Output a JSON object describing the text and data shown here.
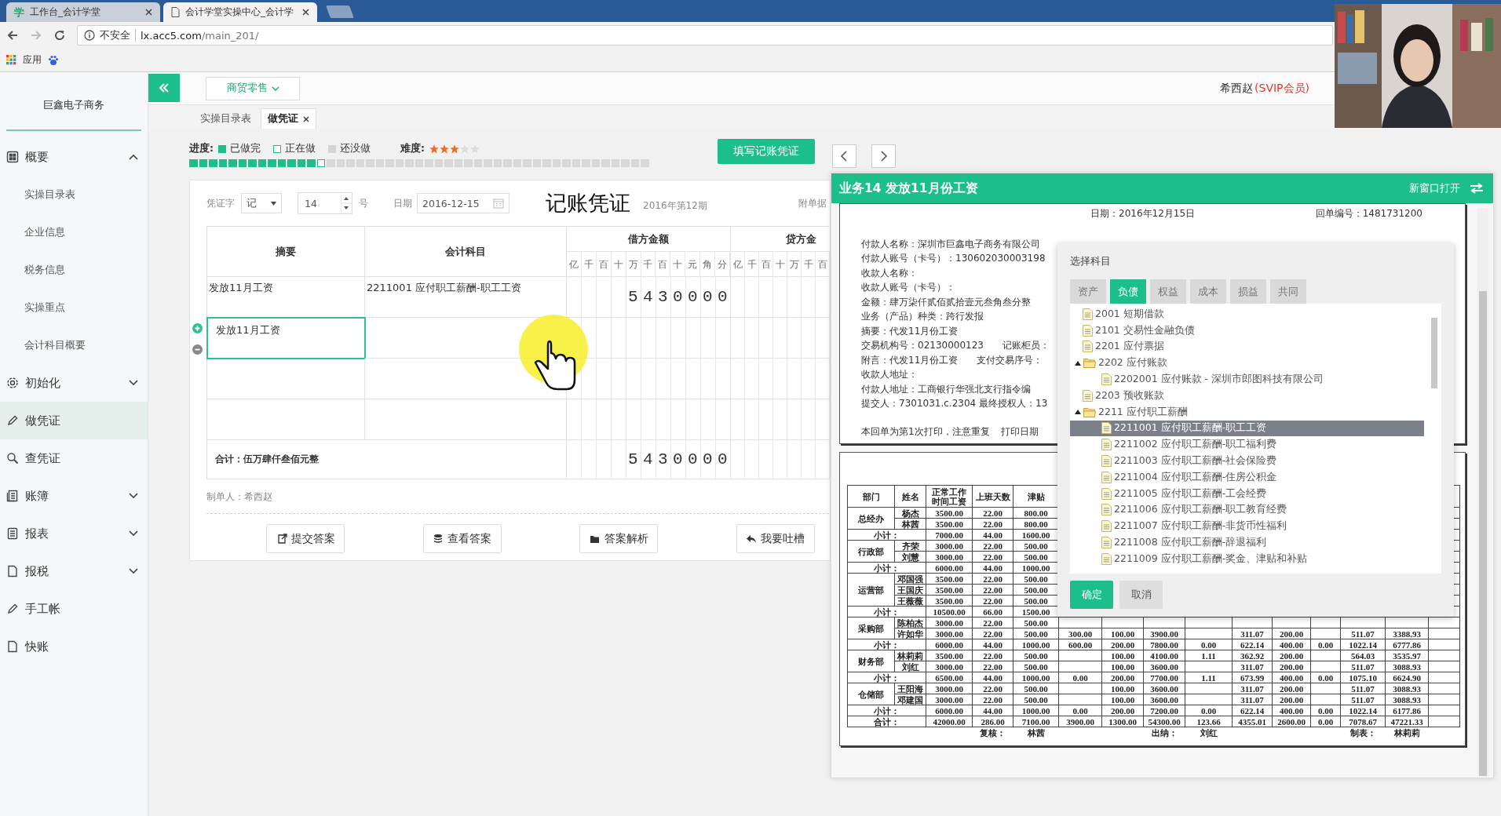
{
  "browser": {
    "tabs": [
      {
        "icon_text": "学",
        "title": "工作台_会计学堂",
        "selected": false
      },
      {
        "title": "会计学堂实操中心_会计学",
        "selected": true
      }
    ],
    "security": "不安全",
    "url_host": "lx.acc5.com",
    "url_path": "/main_201/",
    "bookmarks": [
      "应用"
    ]
  },
  "sidebar": {
    "company": "巨鑫电子商务",
    "items": [
      {
        "label": "概要",
        "selected": false,
        "expanded": true,
        "children": [
          {
            "label": "实操目录表",
            "selected": false
          },
          {
            "label": "企业信息",
            "selected": false
          },
          {
            "label": "税务信息",
            "selected": false
          },
          {
            "label": "实操重点",
            "selected": false
          },
          {
            "label": "会计科目概要",
            "selected": false
          }
        ]
      },
      {
        "label": "初始化",
        "selected": false,
        "expanded": false
      },
      {
        "label": "做凭证",
        "selected": true
      },
      {
        "label": "查凭证",
        "selected": false
      },
      {
        "label": "账簿",
        "selected": false,
        "expanded": false
      },
      {
        "label": "报表",
        "selected": false,
        "expanded": false
      },
      {
        "label": "报税",
        "selected": false,
        "expanded": false
      },
      {
        "label": "手工帐",
        "selected": false
      },
      {
        "label": "快账",
        "selected": false
      }
    ]
  },
  "topbar": {
    "industry": "商贸零售",
    "user": "希西赵",
    "membership": "(SVIP会员)"
  },
  "tabs": [
    {
      "label": "实操目录表",
      "selected": false,
      "closable": false
    },
    {
      "label": "做凭证",
      "selected": true,
      "closable": true
    }
  ],
  "progress": {
    "label": "进度:",
    "legend": [
      {
        "kind": "done",
        "label": "已做完"
      },
      {
        "kind": "doing",
        "label": "正在做"
      },
      {
        "kind": "todo",
        "label": "还没做"
      }
    ],
    "difficulty_label": "难度:",
    "stars": 3,
    "segments": [
      {
        "kind": "done"
      },
      {
        "kind": "done"
      },
      {
        "kind": "done"
      },
      {
        "kind": "done"
      },
      {
        "kind": "done"
      },
      {
        "kind": "done"
      },
      {
        "kind": "done"
      },
      {
        "kind": "done"
      },
      {
        "kind": "done"
      },
      {
        "kind": "done"
      },
      {
        "kind": "done"
      },
      {
        "kind": "done"
      },
      {
        "kind": "done"
      },
      {
        "kind": "doing"
      },
      {
        "kind": "todo"
      },
      {
        "kind": "todo"
      },
      {
        "kind": "todo"
      },
      {
        "kind": "todo"
      },
      {
        "kind": "todo"
      },
      {
        "kind": "todo"
      },
      {
        "kind": "todo"
      },
      {
        "kind": "todo"
      },
      {
        "kind": "todo"
      },
      {
        "kind": "todo"
      },
      {
        "kind": "todo"
      },
      {
        "kind": "todo"
      },
      {
        "kind": "todo"
      },
      {
        "kind": "todo"
      },
      {
        "kind": "todo"
      },
      {
        "kind": "todo"
      },
      {
        "kind": "todo"
      },
      {
        "kind": "todo"
      },
      {
        "kind": "todo"
      },
      {
        "kind": "todo"
      },
      {
        "kind": "todo"
      },
      {
        "kind": "todo"
      },
      {
        "kind": "todo"
      },
      {
        "kind": "todo"
      },
      {
        "kind": "todo"
      },
      {
        "kind": "todo"
      },
      {
        "kind": "todo"
      },
      {
        "kind": "todo"
      },
      {
        "kind": "todo"
      },
      {
        "kind": "todo"
      },
      {
        "kind": "todo"
      },
      {
        "kind": "todo"
      },
      {
        "kind": "todo"
      }
    ]
  },
  "fill_button": "填写记账凭证",
  "voucher": {
    "type_label": "凭证字",
    "type_value": "记",
    "number": "14",
    "number_suffix": "号",
    "date_label": "日期",
    "date": "2016-12-15",
    "title": "记账凭证",
    "period": "2016年第12期",
    "attachments_label": "附单据",
    "columns": {
      "summary": "摘要",
      "account": "会计科目",
      "debit": "借方金额",
      "credit": "贷方金"
    },
    "debit_units": [
      "亿",
      "千",
      "百",
      "十",
      "万",
      "千",
      "百",
      "十",
      "元",
      "角",
      "分"
    ],
    "credit_units": [
      "亿",
      "千",
      "百",
      "十",
      "万",
      "千",
      "百"
    ],
    "entries": [
      {
        "summary": "发放11月工资",
        "account": "2211001 应付职工薪酬-职工工资",
        "debit": "5430000",
        "editing": false
      },
      {
        "summary": "发放11月工资",
        "editing": true
      },
      {
        "editing": false
      },
      {
        "editing": false
      }
    ],
    "total": {
      "label": "合计：伍万肆仟叁佰元整",
      "debit": "5430000"
    },
    "preparer": "制单人：希西赵",
    "actions": [
      "提交答案",
      "查看答案",
      "答案解析",
      "我要吐槽"
    ]
  },
  "task_panel": {
    "title": "业务14 发放11月份工资",
    "open_new": "新窗口打开",
    "receipt": {
      "date": "日期：2016年12月15日",
      "receipt_no": "回单编号：1481731200",
      "lines": [
        [
          "付款人名称：深圳市巨鑫电子商务有限公司"
        ],
        [
          "付款人账号（卡号）：130602030003198"
        ],
        [
          "收款人名称："
        ],
        [
          "收款人账号（卡号）："
        ],
        [
          "金额：肆万柒仟贰佰贰拾壹元叁角叁分整"
        ],
        [
          "业务（产品）种类：跨行发报"
        ],
        [
          "摘要：代发11月份工资"
        ],
        [
          "交易机构号：02130000123",
          "记账柜员："
        ],
        [
          "附言：代发11月份工资",
          "支付交易序号："
        ],
        [
          "收款人地址："
        ],
        [
          "付款人地址：工商银行华强北支行指令编"
        ],
        [
          "提交人：7301031.c.2304 最终授权人：13"
        ]
      ],
      "note": [
        "本回单为第1次打印，注意重复",
        "打印日期"
      ]
    },
    "payroll": {
      "headers": [
        "部门",
        "姓名",
        "正常工作时间工资",
        "上班天数",
        "津贴"
      ],
      "groups": [
        {
          "dept": "总经办",
          "rows": [
            {
              "name": "杨杰",
              "values": [
                "3500.00",
                "22.00",
                "800.00"
              ]
            },
            {
              "name": "林茜",
              "values": [
                "3500.00",
                "22.00",
                "800.00"
              ]
            }
          ],
          "subtotal": {
            "label": "小计：",
            "values": [
              "7000.00",
              "44.00",
              "1600.00"
            ]
          }
        },
        {
          "dept": "行政部",
          "rows": [
            {
              "name": "齐荣",
              "values": [
                "3000.00",
                "22.00",
                "500.00"
              ]
            },
            {
              "name": "刘慧",
              "values": [
                "3000.00",
                "22.00",
                "500.00"
              ]
            }
          ],
          "subtotal": {
            "label": "小计：",
            "values": [
              "6000.00",
              "44.00",
              "1000.00"
            ]
          }
        },
        {
          "dept": "运营部",
          "rows": [
            {
              "name": "邓国强",
              "values": [
                "3500.00",
                "22.00",
                "500.00"
              ]
            },
            {
              "name": "王国庆",
              "values": [
                "3500.00",
                "22.00",
                "500.00"
              ]
            },
            {
              "name": "王薇薇",
              "values": [
                "3500.00",
                "22.00",
                "500.00"
              ]
            }
          ],
          "subtotal": {
            "label": "小计：",
            "values": [
              "10500.00",
              "66.00",
              "1500.00"
            ]
          }
        },
        {
          "dept": "采购部",
          "rows": [
            {
              "name": "陈柏杰",
              "values": [
                "3000.00",
                "22.00",
                "500.00"
              ]
            },
            {
              "name": "许如华",
              "values": [
                "3000.00",
                "22.00",
                "500.00",
                "300.00",
                "100.00",
                "3900.00",
                {
                  "blank": true
                },
                "311.07",
                "200.00",
                {
                  "blank": true
                },
                "511.07",
                "3388.93"
              ]
            }
          ],
          "subtotal": {
            "label": "小计：",
            "values": [
              "6000.00",
              "44.00",
              "1000.00",
              "600.00",
              "200.00",
              "7800.00",
              "0.00",
              "622.14",
              "400.00",
              "0.00",
              "1022.14",
              "6777.86"
            ]
          }
        },
        {
          "dept": "财务部",
          "rows": [
            {
              "name": "林莉莉",
              "values": [
                "3500.00",
                "22.00",
                "500.00",
                {
                  "blank": true
                },
                "100.00",
                "4100.00",
                "1.11",
                "362.92",
                "200.00",
                {
                  "blank": true
                },
                "564.03",
                "3535.97"
              ]
            },
            {
              "name": "刘红",
              "values": [
                "3000.00",
                "22.00",
                "500.00",
                {
                  "blank": true
                },
                "100.00",
                "3600.00",
                {
                  "blank": true
                },
                "311.07",
                "200.00",
                {
                  "blank": true
                },
                "511.07",
                "3088.93"
              ]
            }
          ],
          "subtotal": {
            "label": "小计：",
            "values": [
              "6500.00",
              "44.00",
              "1000.00",
              "0.00",
              "200.00",
              "7700.00",
              "1.11",
              "673.99",
              "400.00",
              "0.00",
              "1075.10",
              "6624.90"
            ]
          }
        },
        {
          "dept": "仓储部",
          "rows": [
            {
              "name": "王阳海",
              "values": [
                "3000.00",
                "22.00",
                "500.00",
                {
                  "blank": true
                },
                "100.00",
                "3600.00",
                {
                  "blank": true
                },
                "311.07",
                "200.00",
                {
                  "blank": true
                },
                "511.07",
                "3088.93"
              ]
            },
            {
              "name": "邓建国",
              "values": [
                "3000.00",
                "22.00",
                "500.00",
                {
                  "blank": true
                },
                "100.00",
                "3600.00",
                {
                  "blank": true
                },
                "311.07",
                "200.00",
                {
                  "blank": true
                },
                "511.07",
                "3088.93"
              ]
            }
          ],
          "subtotal": {
            "label": "小计：",
            "values": [
              "6000.00",
              "44.00",
              "1000.00",
              "0.00",
              "200.00",
              "7200.00",
              "0.00",
              "622.14",
              "400.00",
              "0.00",
              "1022.14",
              "6177.86"
            ]
          }
        }
      ],
      "total": {
        "label": "合计：",
        "values": [
          "42000.00",
          "286.00",
          "7100.00",
          "3900.00",
          "1300.00",
          "54300.00",
          "123.66",
          "4355.01",
          "2600.00",
          "0.00",
          "7078.67",
          "47221.33"
        ]
      },
      "signatures": [
        {
          "label": "复核：",
          "name": "林茜"
        },
        {
          "label": "出纳：",
          "name": "刘红"
        },
        {
          "label": "制表：",
          "name": "林莉莉"
        }
      ]
    }
  },
  "subject_dialog": {
    "title": "选择科目",
    "tabs": [
      {
        "label": "资产",
        "selected": false
      },
      {
        "label": "负债",
        "selected": true
      },
      {
        "label": "权益",
        "selected": false
      },
      {
        "label": "成本",
        "selected": false
      },
      {
        "label": "损益",
        "selected": false
      },
      {
        "label": "共同",
        "selected": false
      }
    ],
    "tree": [
      {
        "label": "2001 短期借款",
        "selected": false
      },
      {
        "label": "2101 交易性金融负债",
        "selected": false
      },
      {
        "label": "2201 应付票据",
        "selected": false
      },
      {
        "label": "2202 应付账款",
        "selected": false,
        "expanded": true,
        "children": [
          {
            "label": "2202001 应付账款 - 深圳市郎图科技有限公司",
            "selected": false
          }
        ]
      },
      {
        "label": "2203 预收账款",
        "selected": false
      },
      {
        "label": "2211 应付职工薪酬",
        "selected": false,
        "expanded": true,
        "children": [
          {
            "label": "2211001 应付职工薪酬-职工工资",
            "selected": true
          },
          {
            "label": "2211002 应付职工薪酬-职工福利费",
            "selected": false
          },
          {
            "label": "2211003 应付职工薪酬-社会保险费",
            "selected": false
          },
          {
            "label": "2211004 应付职工薪酬-住房公积金",
            "selected": false
          },
          {
            "label": "2211005 应付职工薪酬-工会经费",
            "selected": false
          },
          {
            "label": "2211006 应付职工薪酬-职工教育经费",
            "selected": false
          },
          {
            "label": "2211007 应付职工薪酬-非货币性福利",
            "selected": false
          },
          {
            "label": "2211008 应付职工薪酬-辞退福利",
            "selected": false
          },
          {
            "label": "2211009 应付职工薪酬-奖金、津贴和补贴",
            "selected": false
          }
        ]
      }
    ],
    "confirm": "确定",
    "cancel": "取消"
  }
}
